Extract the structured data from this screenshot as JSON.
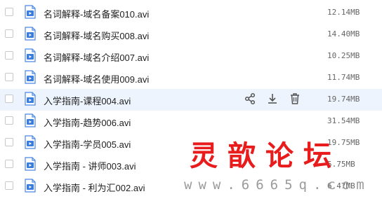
{
  "files": [
    {
      "name": "名词解释-域名备案010.avi",
      "size": "12.14MB"
    },
    {
      "name": "名词解释-域名购买008.avi",
      "size": "14.40MB"
    },
    {
      "name": "名词解释-域名介绍007.avi",
      "size": "10.25MB"
    },
    {
      "name": "名词解释-域名使用009.avi",
      "size": "11.74MB"
    },
    {
      "name": "入学指南-课程004.avi",
      "size": "19.74MB",
      "hovered": true
    },
    {
      "name": "入学指南-趋势006.avi",
      "size": "31.54MB"
    },
    {
      "name": "入学指南-学员005.avi",
      "size": "19.75MB"
    },
    {
      "name": "入学指南 - 讲师003.avi",
      "size": "5.75MB"
    },
    {
      "name": "入学指南 - 利为汇002.avi",
      "size": "6.47MB"
    }
  ],
  "row_actions": [
    "share-icon",
    "download-icon",
    "delete-icon"
  ],
  "watermark": {
    "title": "灵歆论坛",
    "url": "www.6665q.com"
  },
  "colors": {
    "accent": "#3b8cff",
    "hover_row": "#edf4fd",
    "watermark_red": "#e81c1c"
  }
}
